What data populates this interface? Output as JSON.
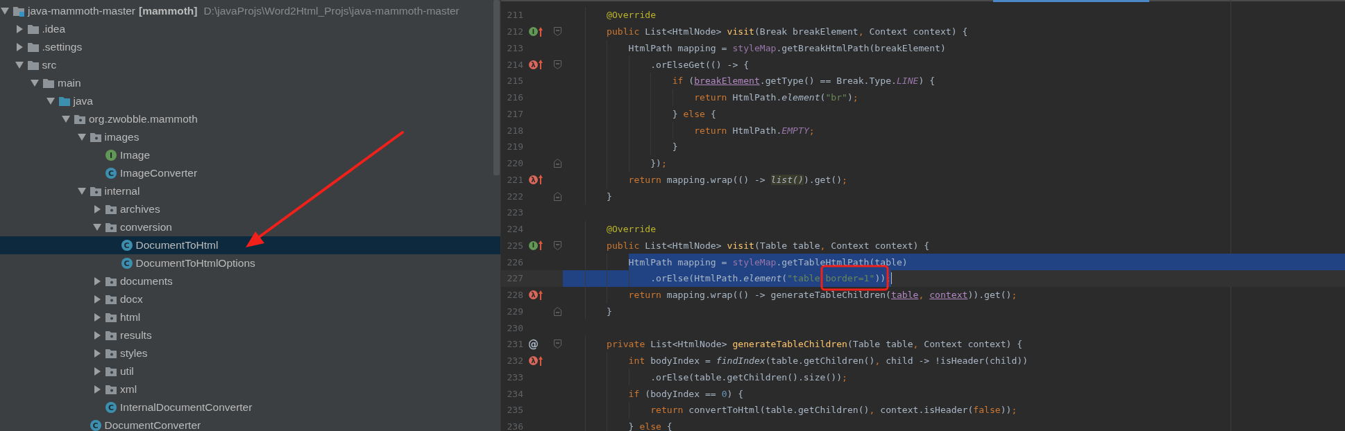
{
  "project_tree": {
    "root": {
      "label": "java-mammoth-master",
      "module": "[mammoth]",
      "path": "D:\\javaProjs\\Word2Html_Projs\\java-mammoth-master",
      "expanded": true,
      "selected": false
    },
    "items": [
      {
        "label": ".idea",
        "kind": "folder",
        "expanded": false,
        "selected": false
      },
      {
        "label": ".settings",
        "kind": "folder",
        "expanded": false,
        "selected": false
      },
      {
        "label": "src",
        "kind": "folder",
        "expanded": true,
        "selected": false,
        "children": [
          {
            "label": "main",
            "kind": "folder",
            "expanded": true,
            "selected": false,
            "children": [
              {
                "label": "java",
                "kind": "source-folder",
                "expanded": true,
                "selected": false,
                "children": [
                  {
                    "label": "org.zwobble.mammoth",
                    "kind": "package",
                    "expanded": true,
                    "selected": false,
                    "children": [
                      {
                        "label": "images",
                        "kind": "package",
                        "expanded": true,
                        "selected": false,
                        "children": [
                          {
                            "label": "Image",
                            "kind": "interface",
                            "badge": "I",
                            "selected": false
                          },
                          {
                            "label": "ImageConverter",
                            "kind": "class",
                            "badge": "C",
                            "selected": false
                          }
                        ]
                      },
                      {
                        "label": "internal",
                        "kind": "package",
                        "expanded": true,
                        "selected": false,
                        "children": [
                          {
                            "label": "archives",
                            "kind": "package",
                            "expanded": false,
                            "selected": false
                          },
                          {
                            "label": "conversion",
                            "kind": "package",
                            "expanded": true,
                            "selected": false,
                            "children": [
                              {
                                "label": "DocumentToHtml",
                                "kind": "class",
                                "badge": "C",
                                "selected": true
                              },
                              {
                                "label": "DocumentToHtmlOptions",
                                "kind": "class",
                                "badge": "C",
                                "selected": false
                              }
                            ]
                          },
                          {
                            "label": "documents",
                            "kind": "package",
                            "expanded": false,
                            "selected": false
                          },
                          {
                            "label": "docx",
                            "kind": "package",
                            "expanded": false,
                            "selected": false
                          },
                          {
                            "label": "html",
                            "kind": "package",
                            "expanded": false,
                            "selected": false
                          },
                          {
                            "label": "results",
                            "kind": "package",
                            "expanded": false,
                            "selected": false
                          },
                          {
                            "label": "styles",
                            "kind": "package",
                            "expanded": false,
                            "selected": false
                          },
                          {
                            "label": "util",
                            "kind": "package",
                            "expanded": false,
                            "selected": false
                          },
                          {
                            "label": "xml",
                            "kind": "package",
                            "expanded": false,
                            "selected": false
                          },
                          {
                            "label": "InternalDocumentConverter",
                            "kind": "class",
                            "badge": "C",
                            "selected": false
                          }
                        ]
                      },
                      {
                        "label": "DocumentConverter",
                        "kind": "class",
                        "badge": "C",
                        "selected": false
                      }
                    ]
                  }
                ]
              }
            ]
          }
        ]
      }
    ]
  },
  "editor": {
    "lines": [
      {
        "number": "211",
        "tokens": [
          {
            "kind": "annotation",
            "text": "        @Override"
          }
        ]
      },
      {
        "number": "212",
        "gutter": {
          "kind": "implements",
          "glyph": "I"
        },
        "fold": {
          "kind": "start"
        },
        "tokens": [
          {
            "kind": "keyword",
            "text": "        public "
          },
          {
            "kind": "plain",
            "text": "List<HtmlNode> "
          },
          {
            "kind": "declaration",
            "text": "visit"
          },
          {
            "kind": "plain",
            "text": "(Break breakElement"
          },
          {
            "kind": "punct",
            "text": ", "
          },
          {
            "kind": "plain",
            "text": "Context context) {"
          }
        ]
      },
      {
        "number": "213",
        "tokens": [
          {
            "kind": "plain",
            "text": "            HtmlPath mapping = "
          },
          {
            "kind": "field",
            "text": "styleMap"
          },
          {
            "kind": "plain",
            "text": ".getBreakHtmlPath(breakElement)"
          }
        ]
      },
      {
        "number": "214",
        "gutter": {
          "kind": "lambda",
          "glyph": "λ"
        },
        "fold": {
          "kind": "start"
        },
        "tokens": [
          {
            "kind": "plain",
            "text": "                .orElseGet(() -> {"
          }
        ]
      },
      {
        "number": "215",
        "tokens": [
          {
            "kind": "keyword",
            "text": "                    if "
          },
          {
            "kind": "plain",
            "text": "("
          },
          {
            "kind": "captured",
            "text": "breakElement"
          },
          {
            "kind": "plain",
            "text": ".getType() == Break.Type."
          },
          {
            "kind": "constant",
            "text": "LINE"
          },
          {
            "kind": "plain",
            "text": ") {"
          }
        ]
      },
      {
        "number": "216",
        "tokens": [
          {
            "kind": "keyword",
            "text": "                        return "
          },
          {
            "kind": "plain",
            "text": "HtmlPath."
          },
          {
            "kind": "static",
            "text": "element"
          },
          {
            "kind": "plain",
            "text": "("
          },
          {
            "kind": "string",
            "text": "\"br\""
          },
          {
            "kind": "plain",
            "text": ")"
          },
          {
            "kind": "punct",
            "text": ";"
          }
        ]
      },
      {
        "number": "217",
        "tokens": [
          {
            "kind": "plain",
            "text": "                    } "
          },
          {
            "kind": "keyword",
            "text": "else "
          },
          {
            "kind": "plain",
            "text": "{"
          }
        ]
      },
      {
        "number": "218",
        "tokens": [
          {
            "kind": "keyword",
            "text": "                        return "
          },
          {
            "kind": "plain",
            "text": "HtmlPath."
          },
          {
            "kind": "constant",
            "text": "EMPTY"
          },
          {
            "kind": "punct",
            "text": ";"
          }
        ]
      },
      {
        "number": "219",
        "tokens": [
          {
            "kind": "plain",
            "text": "                    }"
          }
        ]
      },
      {
        "number": "220",
        "fold": {
          "kind": "end"
        },
        "tokens": [
          {
            "kind": "plain",
            "text": "                })"
          },
          {
            "kind": "punct",
            "text": ";"
          }
        ]
      },
      {
        "number": "221",
        "gutter": {
          "kind": "lambda",
          "glyph": "λ"
        },
        "tokens": [
          {
            "kind": "keyword",
            "text": "            return "
          },
          {
            "kind": "plain",
            "text": "mapping.wrap(() -> "
          },
          {
            "kind": "match",
            "text": "list()"
          },
          {
            "kind": "plain",
            "text": ").get()"
          },
          {
            "kind": "punct",
            "text": ";"
          }
        ]
      },
      {
        "number": "222",
        "fold": {
          "kind": "end"
        },
        "tokens": [
          {
            "kind": "plain",
            "text": "        }"
          }
        ]
      },
      {
        "number": "223"
      },
      {
        "number": "224",
        "tokens": [
          {
            "kind": "annotation",
            "text": "        @Override"
          }
        ]
      },
      {
        "number": "225",
        "gutter": {
          "kind": "implements",
          "glyph": "I"
        },
        "fold": {
          "kind": "start"
        },
        "tokens": [
          {
            "kind": "keyword",
            "text": "        public "
          },
          {
            "kind": "plain",
            "text": "List<HtmlNode> "
          },
          {
            "kind": "declaration",
            "text": "visit"
          },
          {
            "kind": "plain",
            "text": "(Table table"
          },
          {
            "kind": "punct",
            "text": ", "
          },
          {
            "kind": "plain",
            "text": "Context context) {"
          }
        ]
      },
      {
        "number": "226",
        "selected": true,
        "caret": false,
        "tokens": [
          {
            "kind": "plain",
            "text": "            HtmlPath mapping = "
          },
          {
            "kind": "field",
            "text": "styleMap"
          },
          {
            "kind": "plain",
            "text": ".getTableHtmlPath(table)"
          }
        ]
      },
      {
        "number": "227",
        "selected": true,
        "caret": true,
        "tokens": [
          {
            "kind": "plain",
            "text": "                .orElse(HtmlPath."
          },
          {
            "kind": "static",
            "text": "element"
          },
          {
            "kind": "plain",
            "text": "("
          },
          {
            "kind": "string",
            "text": "\"table border=1\""
          },
          {
            "kind": "plain",
            "text": "))"
          },
          {
            "kind": "punct",
            "text": ";"
          }
        ]
      },
      {
        "number": "228",
        "gutter": {
          "kind": "lambda",
          "glyph": "λ"
        },
        "tokens": [
          {
            "kind": "keyword",
            "text": "            return "
          },
          {
            "kind": "plain",
            "text": "mapping.wrap(() -> generateTableChildren("
          },
          {
            "kind": "captured",
            "text": "table"
          },
          {
            "kind": "punct",
            "text": ", "
          },
          {
            "kind": "captured",
            "text": "context"
          },
          {
            "kind": "plain",
            "text": ")).get()"
          },
          {
            "kind": "punct",
            "text": ";"
          }
        ]
      },
      {
        "number": "229",
        "fold": {
          "kind": "end"
        },
        "tokens": [
          {
            "kind": "plain",
            "text": "        }"
          }
        ]
      },
      {
        "number": "230"
      },
      {
        "number": "231",
        "gutter": {
          "kind": "overrides",
          "glyph": "@"
        },
        "fold": {
          "kind": "start"
        },
        "tokens": [
          {
            "kind": "keyword",
            "text": "        private "
          },
          {
            "kind": "plain",
            "text": "List<HtmlNode> "
          },
          {
            "kind": "declaration",
            "text": "generateTableChildren"
          },
          {
            "kind": "plain",
            "text": "(Table table"
          },
          {
            "kind": "punct",
            "text": ", "
          },
          {
            "kind": "plain",
            "text": "Context context) {"
          }
        ]
      },
      {
        "number": "232",
        "gutter": {
          "kind": "lambda",
          "glyph": "λ"
        },
        "tokens": [
          {
            "kind": "keyword",
            "text": "            int "
          },
          {
            "kind": "plain",
            "text": "bodyIndex = "
          },
          {
            "kind": "static",
            "text": "findIndex"
          },
          {
            "kind": "plain",
            "text": "(table.getChildren()"
          },
          {
            "kind": "punct",
            "text": ", "
          },
          {
            "kind": "plain",
            "text": "child -> !isHeader(child))"
          }
        ]
      },
      {
        "number": "233",
        "tokens": [
          {
            "kind": "plain",
            "text": "                .orElse(table.getChildren().size())"
          },
          {
            "kind": "punct",
            "text": ";"
          }
        ]
      },
      {
        "number": "234",
        "tokens": [
          {
            "kind": "keyword",
            "text": "            if "
          },
          {
            "kind": "plain",
            "text": "(bodyIndex == "
          },
          {
            "kind": "number",
            "text": "0"
          },
          {
            "kind": "plain",
            "text": ") {"
          }
        ]
      },
      {
        "number": "235",
        "tokens": [
          {
            "kind": "keyword",
            "text": "                return "
          },
          {
            "kind": "plain",
            "text": "convertToHtml(table.getChildren()"
          },
          {
            "kind": "punct",
            "text": ", "
          },
          {
            "kind": "plain",
            "text": "context.isHeader("
          },
          {
            "kind": "keyword",
            "text": "false"
          },
          {
            "kind": "plain",
            "text": "))"
          },
          {
            "kind": "punct",
            "text": ";"
          }
        ]
      },
      {
        "number": "236",
        "tokens": [
          {
            "kind": "plain",
            "text": "            } "
          },
          {
            "kind": "keyword",
            "text": "else "
          },
          {
            "kind": "plain",
            "text": "{"
          }
        ]
      }
    ]
  }
}
